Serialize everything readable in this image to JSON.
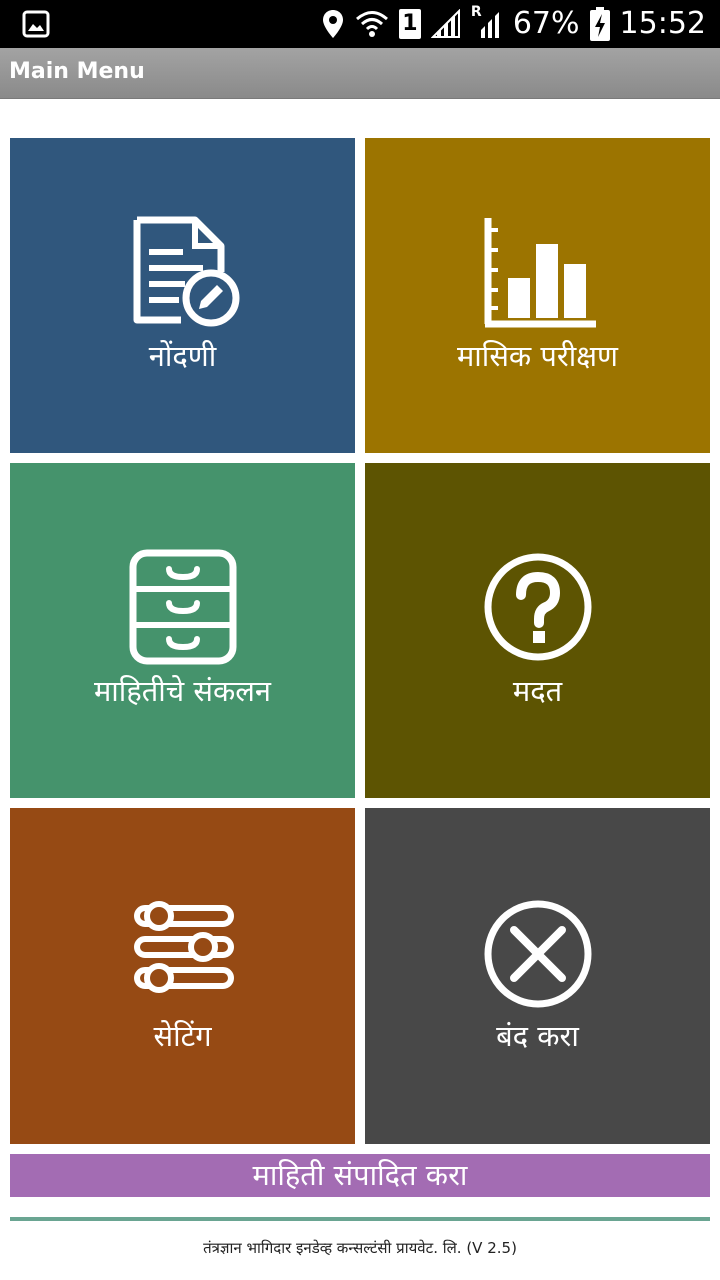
{
  "status_bar": {
    "battery": "67%",
    "time": "15:52",
    "sim_slot": "1",
    "roaming": "R"
  },
  "app_bar": {
    "title": "Main Menu"
  },
  "tiles": [
    {
      "label": "नोंदणी",
      "icon": "document-edit-icon",
      "color": "#30577d"
    },
    {
      "label": "मासिक परीक्षण",
      "icon": "bar-chart-icon",
      "color": "#9c7400"
    },
    {
      "label": "माहितीचे संकलन",
      "icon": "file-cabinet-icon",
      "color": "#45936c"
    },
    {
      "label": "मदत",
      "icon": "help-icon",
      "color": "#5d5402"
    },
    {
      "label": "सेटिंग",
      "icon": "sliders-icon",
      "color": "#964a14"
    },
    {
      "label": "बंद करा",
      "icon": "close-icon",
      "color": "#484848"
    }
  ],
  "edit_button": {
    "label": "माहिती संपादित करा",
    "color": "#a36cb3"
  },
  "footer": {
    "text": "तंत्रज्ञान भागिदार इनडेव्ह कन्सल्टंसी प्रायवेट. लि. (V 2.5)"
  }
}
